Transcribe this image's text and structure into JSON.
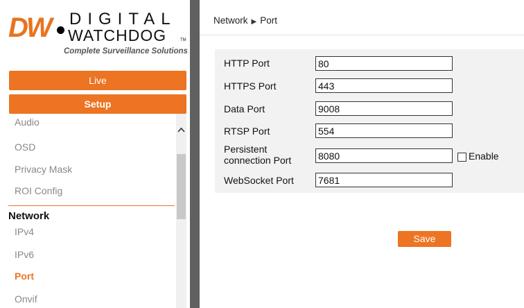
{
  "logo": {
    "brand_mark": "DW",
    "brand_word1": "DIGITAL",
    "brand_word2": "WATCHDOG",
    "trademark": "TM",
    "tagline": "Complete Surveillance Solutions"
  },
  "nav": {
    "live_label": "Live",
    "setup_label": "Setup"
  },
  "menu": {
    "items_above": [
      "Audio",
      "OSD",
      "Privacy Mask",
      "ROI Config"
    ],
    "group_label": "Network",
    "items_below": [
      "IPv4",
      "IPv6",
      "Port",
      "Onvif"
    ],
    "active_item": "Port",
    "scroll_up_icon": "chevron-up-icon"
  },
  "breadcrumb": {
    "section": "Network",
    "separator_icon": "triangle-right-icon",
    "page": "Port"
  },
  "form": {
    "http_label": "HTTP Port",
    "http_value": "80",
    "https_label": "HTTPS Port",
    "https_value": "443",
    "data_label": "Data Port",
    "data_value": "9008",
    "rtsp_label": "RTSP Port",
    "rtsp_value": "554",
    "persistent_label_line1": "Persistent",
    "persistent_label_line2": "connection Port",
    "persistent_value": "8080",
    "enable_label": "Enable",
    "enable_checked": false,
    "websocket_label": "WebSocket Port",
    "websocket_value": "7681"
  },
  "actions": {
    "save_label": "Save"
  },
  "colors": {
    "accent": "#ec7422",
    "divider": "#606060",
    "panel_bg": "#f2f2f2",
    "menu_text": "#888888"
  }
}
